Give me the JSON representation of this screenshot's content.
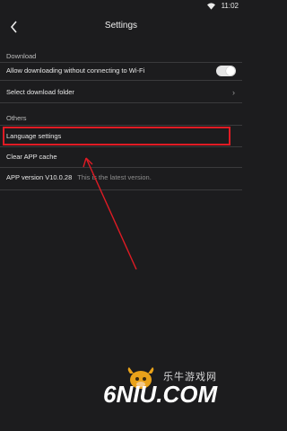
{
  "status_bar": {
    "time": "11:02",
    "wifi_icon": "wifi-icon"
  },
  "header": {
    "title": "Settings",
    "back_icon": "chevron-left-icon"
  },
  "sections": {
    "download": {
      "label": "Download",
      "items": [
        {
          "label": "Allow downloading without connecting to Wi-Fi",
          "toggle_on": true
        },
        {
          "label": "Select download folder",
          "chevron": "chevron-right-icon"
        }
      ]
    },
    "others": {
      "label": "Others",
      "items": [
        {
          "label": "Language settings"
        },
        {
          "label": "Clear APP cache"
        },
        {
          "label": "APP version V10.0.28",
          "sub": "This is the latest version."
        }
      ]
    }
  },
  "annotation": {
    "highlight_color": "#e01b24",
    "arrow_color": "#e01b24"
  },
  "watermark": {
    "cn_text": "乐牛游戏网",
    "logo_text": "NIU.COM",
    "logo_six": "6"
  }
}
